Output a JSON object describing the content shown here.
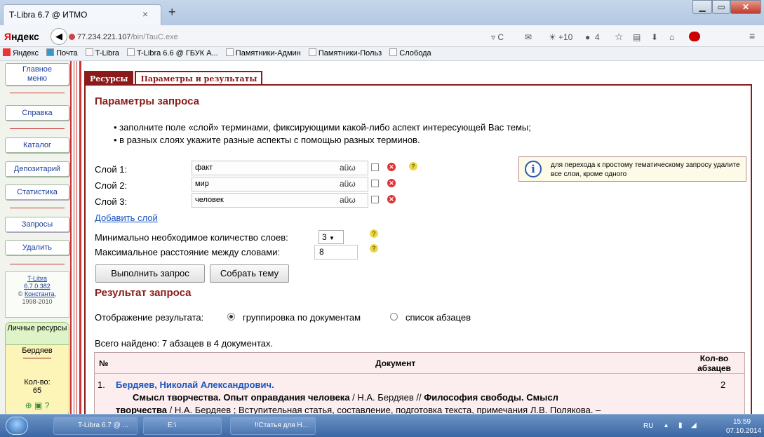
{
  "browser": {
    "tab_title": "T-Libra 6.7 @ ИТМО",
    "tab_close": "×",
    "new_tab": "+",
    "logo_prefix": "Я",
    "logo_text": "ндекс",
    "url_host": "77.234.221.107",
    "url_path": "/bin/TauC.exe",
    "weather": "+10",
    "notif_count": "4",
    "reload": "▿ C",
    "bookmarks": [
      "Яндекс",
      "Почта",
      "T-Libra",
      "T-Libra 6.6 @ ГБУК А...",
      "Памятники-Админ",
      "Памятники-Польз",
      "Слобода"
    ]
  },
  "sidebar": {
    "items": [
      {
        "label": "Главное\nменю"
      },
      {
        "label": "Справка"
      },
      {
        "label": "Каталог"
      },
      {
        "label": "Депозитарий"
      },
      {
        "label": "Статистика"
      },
      {
        "label": "Запросы"
      },
      {
        "label": "Удалить"
      }
    ],
    "info_product": "T-Libra",
    "info_version": "6.7.0.382",
    "info_copy": "©",
    "info_company": "Константа",
    "info_years": "1998-2010",
    "lr_title": "Личные ресурсы",
    "lr_item": "Бердяев",
    "lr_count_label": "Кол-во:",
    "lr_count": "65"
  },
  "tabs": {
    "resources": "Ресурсы",
    "params": "Параметры и результаты"
  },
  "query": {
    "title": "Параметры запроса",
    "bullet1": "• заполните поле «слой» терминами, фиксирующими какой-либо аспект интересующей Вас темы;",
    "bullet2": "• в разных слоях укажите разные аспекты с помощью разных терминов.",
    "layers": [
      {
        "label": "Слой 1:",
        "value": "факт"
      },
      {
        "label": "Слой 2:",
        "value": "мир"
      },
      {
        "label": "Слой 3:",
        "value": "человек"
      }
    ],
    "kbd_label": "aüω",
    "add_layer": "Добавить слой",
    "hint": "для перехода к простому тематическому запросу удалите все слои, кроме одного",
    "min_layers_label": "Минимально необходимое количество слоев:",
    "min_layers_value": "3",
    "max_dist_label": "Максимальное расстояние между словами:",
    "max_dist_value": "8",
    "run_button": "Выполнить запрос",
    "collect_button": "Собрать тему"
  },
  "result": {
    "title": "Результат запроса",
    "display_label": "Отображение результата:",
    "opt_group": "группировка по документам",
    "opt_list": "список абзацев",
    "total": "Всего найдено: 7 абзацев в 4 документах.",
    "columns": {
      "num": "№",
      "doc": "Документ",
      "count": "Кол-во абзацев"
    },
    "rows": [
      {
        "num": "1.",
        "author": "Бердяев, Николай Александрович.",
        "count": "2",
        "line1_b1": "Смысл творчества. Опыт оправдания человека",
        "line1_t1": " / Н.А. Бердяев // ",
        "line1_b2": "Философия свободы. Смысл",
        "line2_b1": "творчества",
        "line2_t1": " / Н.А. Бердяев ; Вступительная статья, составление, подготовка текста, примечания Л.В. Полякова. –"
      }
    ]
  },
  "taskbar": {
    "items": [
      "T-Libra 6.7 @ ...",
      "E:\\",
      "!!Статья для Н..."
    ],
    "lang": "RU",
    "time": "15:59",
    "date": "07.10.2014"
  }
}
